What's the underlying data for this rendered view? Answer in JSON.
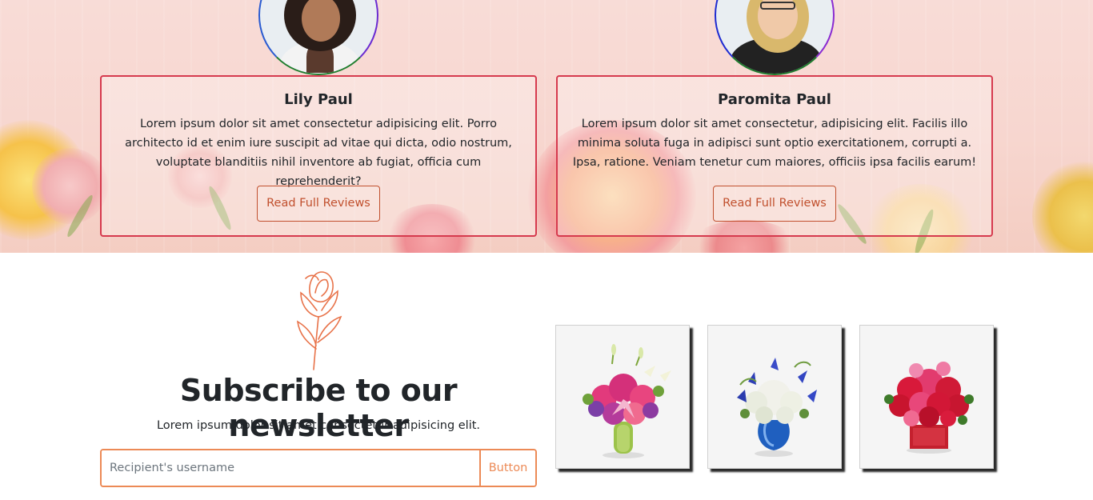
{
  "reviews": [
    {
      "name": "Lily Paul",
      "text": "Lorem ipsum dolor sit amet consectetur adipisicing elit. Porro architecto id et enim iure suscipit ad vitae qui dicta, odio nostrum, voluptate blanditiis nihil inventore ab fugiat, officia cum reprehenderit?",
      "button_label": "Read Full Reviews"
    },
    {
      "name": "Paromita Paul",
      "text": "Lorem ipsum dolor sit amet consectetur, adipisicing elit. Facilis illo minima soluta fuga in adipisci sunt optio exercitationem, corrupti a. Ipsa, ratione. Veniam tenetur cum maiores, officiis ipsa facilis earum!",
      "button_label": "Read Full Reviews"
    }
  ],
  "newsletter": {
    "title": "Subscribe to our newsletter",
    "subtitle": "Lorem ipsum dolor sit amet consectetur adipisicing elit.",
    "input_placeholder": "Recipient's username",
    "button_label": "Button"
  },
  "products": [
    {
      "name": "pink-lily-bouquet"
    },
    {
      "name": "blue-white-bouquet"
    },
    {
      "name": "red-rose-bouquet"
    }
  ],
  "colors": {
    "accent": "#ec8a56",
    "card_border": "#d63a4e",
    "review_button": "#c1502e"
  }
}
